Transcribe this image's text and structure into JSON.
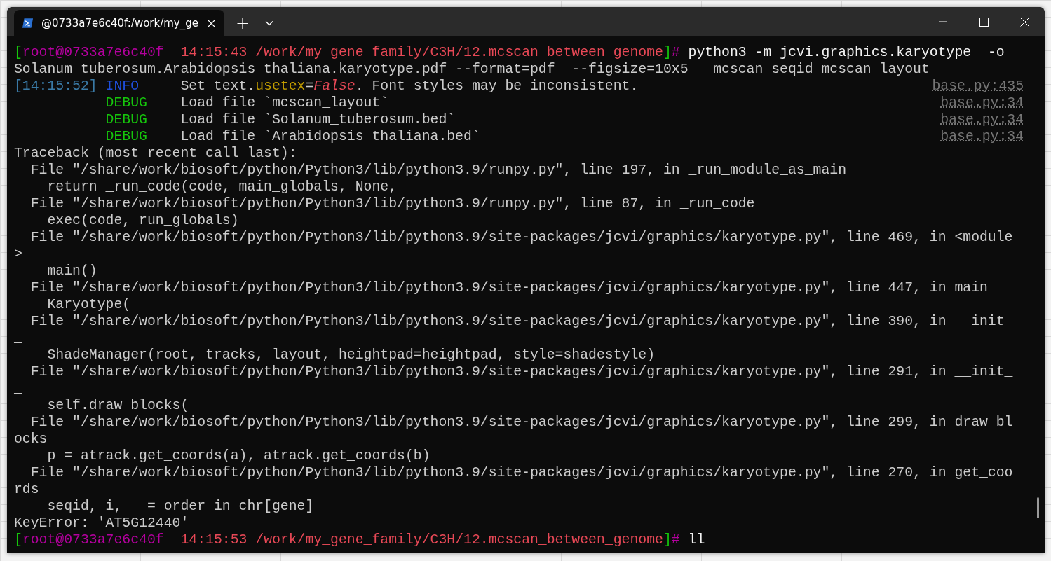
{
  "window": {
    "tabs": [
      {
        "title": "@0733a7e6c40f:/work/my_ge",
        "selected": true
      }
    ],
    "new_tab": "+"
  },
  "terminal": {
    "lines": [
      {
        "kind": "prompt",
        "segments": [
          {
            "kind": "bracket",
            "text": "["
          },
          {
            "kind": "user",
            "text": "root@0733a7e6c40f"
          },
          {
            "kind": "path",
            "text": "  14:15:43 /work/my_gene_family/C3H/12.mcscan_between_genome"
          },
          {
            "kind": "bracket",
            "text": "]"
          },
          {
            "kind": "symbol",
            "text": "#"
          },
          {
            "kind": "command",
            "text": " python3 -m jcvi.graphics.karyotype  -o"
          }
        ]
      },
      {
        "kind": "output",
        "text": "Solanum_tuberosum.Arabidopsis_thaliana.karyotype.pdf --format=pdf  --figsize=10x5   mcscan_seqid mcscan_layout"
      },
      {
        "kind": "log",
        "time": "[14:15:52]",
        "level": {
          "kind": "info",
          "text": "INFO"
        },
        "message": [
          {
            "kind": "text",
            "text": "Set text."
          },
          {
            "kind": "attr",
            "text": "usetex"
          },
          {
            "kind": "text",
            "text": "="
          },
          {
            "kind": "value",
            "text": "False"
          },
          {
            "kind": "text",
            "text": ". Font styles may be inconsistent."
          }
        ],
        "source": "base.py:435"
      },
      {
        "kind": "log",
        "level": {
          "kind": "debug",
          "text": "DEBUG"
        },
        "message": [
          {
            "kind": "text",
            "text": "Load file `mcscan_layout`"
          }
        ],
        "source": "base.py:34"
      },
      {
        "kind": "log",
        "level": {
          "kind": "debug",
          "text": "DEBUG"
        },
        "message": [
          {
            "kind": "text",
            "text": "Load file `Solanum_tuberosum.bed`"
          }
        ],
        "source": "base.py:34"
      },
      {
        "kind": "log",
        "level": {
          "kind": "debug",
          "text": "DEBUG"
        },
        "message": [
          {
            "kind": "text",
            "text": "Load file `Arabidopsis_thaliana.bed`"
          }
        ],
        "source": "base.py:34"
      },
      {
        "kind": "output",
        "text": "Traceback (most recent call last):"
      },
      {
        "kind": "output",
        "text": "  File \"/share/work/biosoft/python/Python3/lib/python3.9/runpy.py\", line 197, in _run_module_as_main"
      },
      {
        "kind": "output",
        "text": "    return _run_code(code, main_globals, None,"
      },
      {
        "kind": "output",
        "text": "  File \"/share/work/biosoft/python/Python3/lib/python3.9/runpy.py\", line 87, in _run_code"
      },
      {
        "kind": "output",
        "text": "    exec(code, run_globals)"
      },
      {
        "kind": "output",
        "text": "  File \"/share/work/biosoft/python/Python3/lib/python3.9/site-packages/jcvi/graphics/karyotype.py\", line 469, in <module"
      },
      {
        "kind": "output",
        "text": ">"
      },
      {
        "kind": "output",
        "text": "    main()"
      },
      {
        "kind": "output",
        "text": "  File \"/share/work/biosoft/python/Python3/lib/python3.9/site-packages/jcvi/graphics/karyotype.py\", line 447, in main"
      },
      {
        "kind": "output",
        "text": "    Karyotype("
      },
      {
        "kind": "output",
        "text": "  File \"/share/work/biosoft/python/Python3/lib/python3.9/site-packages/jcvi/graphics/karyotype.py\", line 390, in __init_"
      },
      {
        "kind": "output",
        "text": "_"
      },
      {
        "kind": "output",
        "text": "    ShadeManager(root, tracks, layout, heightpad=heightpad, style=shadestyle)"
      },
      {
        "kind": "output",
        "text": "  File \"/share/work/biosoft/python/Python3/lib/python3.9/site-packages/jcvi/graphics/karyotype.py\", line 291, in __init_"
      },
      {
        "kind": "output",
        "text": "_"
      },
      {
        "kind": "output",
        "text": "    self.draw_blocks("
      },
      {
        "kind": "output",
        "text": "  File \"/share/work/biosoft/python/Python3/lib/python3.9/site-packages/jcvi/graphics/karyotype.py\", line 299, in draw_bl"
      },
      {
        "kind": "output",
        "text": "ocks"
      },
      {
        "kind": "output",
        "text": "    p = atrack.get_coords(a), atrack.get_coords(b)"
      },
      {
        "kind": "output",
        "text": "  File \"/share/work/biosoft/python/Python3/lib/python3.9/site-packages/jcvi/graphics/karyotype.py\", line 270, in get_coo"
      },
      {
        "kind": "output",
        "text": "rds"
      },
      {
        "kind": "output",
        "text": "    seqid, i, _ = order_in_chr[gene]"
      },
      {
        "kind": "output",
        "text": "KeyError: 'AT5G12440'"
      },
      {
        "kind": "prompt",
        "segments": [
          {
            "kind": "bracket",
            "text": "["
          },
          {
            "kind": "user",
            "text": "root@0733a7e6c40f"
          },
          {
            "kind": "path",
            "text": "  14:15:53 /work/my_gene_family/C3H/12.mcscan_between_genome"
          },
          {
            "kind": "bracket",
            "text": "]"
          },
          {
            "kind": "symbol",
            "text": "#"
          },
          {
            "kind": "command",
            "text": " ll"
          }
        ]
      }
    ]
  }
}
